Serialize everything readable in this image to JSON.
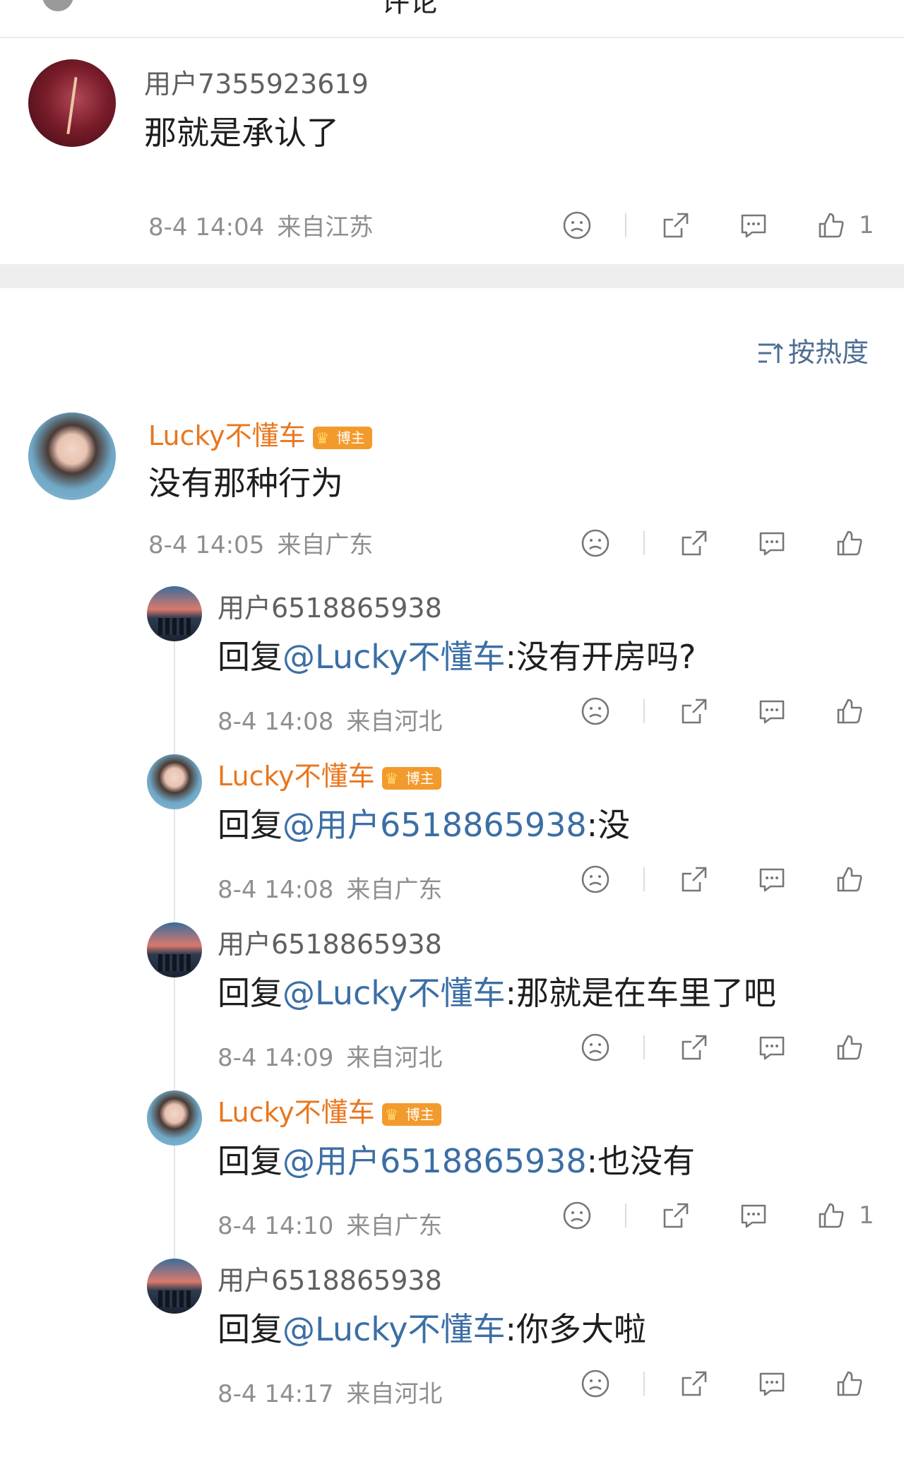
{
  "header": {
    "title": "评论",
    "more": "⋯"
  },
  "sort": {
    "label": "按热度",
    "icon": "sort-icon"
  },
  "comments": [
    {
      "user": "用户7355923619",
      "vip": false,
      "text": "那就是承认了",
      "mention": "",
      "reply": "",
      "time": "8-4 14:04",
      "location": "来自江苏",
      "likes": "1"
    },
    {
      "user": "Lucky不懂车",
      "vip": true,
      "badge": "博主",
      "text": "没有那种行为",
      "mention": "",
      "reply": "",
      "time": "8-4 14:05",
      "location": "来自广东",
      "likes": ""
    }
  ],
  "replies": [
    {
      "user": "用户6518865938",
      "vip": false,
      "prefix": "回复",
      "mention": "@Lucky不懂车",
      "reply": ":没有开房吗?",
      "time": "8-4 14:08",
      "location": "来自河北",
      "likes": ""
    },
    {
      "user": "Lucky不懂车",
      "vip": true,
      "badge": "博主",
      "prefix": "回复",
      "mention": "@用户6518865938",
      "reply": ":没",
      "time": "8-4 14:08",
      "location": "来自广东",
      "likes": ""
    },
    {
      "user": "用户6518865938",
      "vip": false,
      "prefix": "回复",
      "mention": "@Lucky不懂车",
      "reply": ":那就是在车里了吧",
      "time": "8-4 14:09",
      "location": "来自河北",
      "likes": ""
    },
    {
      "user": "Lucky不懂车",
      "vip": true,
      "badge": "博主",
      "prefix": "回复",
      "mention": "@用户6518865938",
      "reply": ":也没有",
      "time": "8-4 14:10",
      "location": "来自广东",
      "likes": "1"
    },
    {
      "user": "用户6518865938",
      "vip": false,
      "prefix": "回复",
      "mention": "@Lucky不懂车",
      "reply": ":你多大啦",
      "time": "8-4 14:17",
      "location": "来自河北",
      "likes": ""
    }
  ],
  "badge_level": "5",
  "colors": {
    "vip_name": "#e9761d",
    "mention": "#3b6ea5",
    "meta": "#8f8f8f",
    "band": "#eeeeef"
  }
}
